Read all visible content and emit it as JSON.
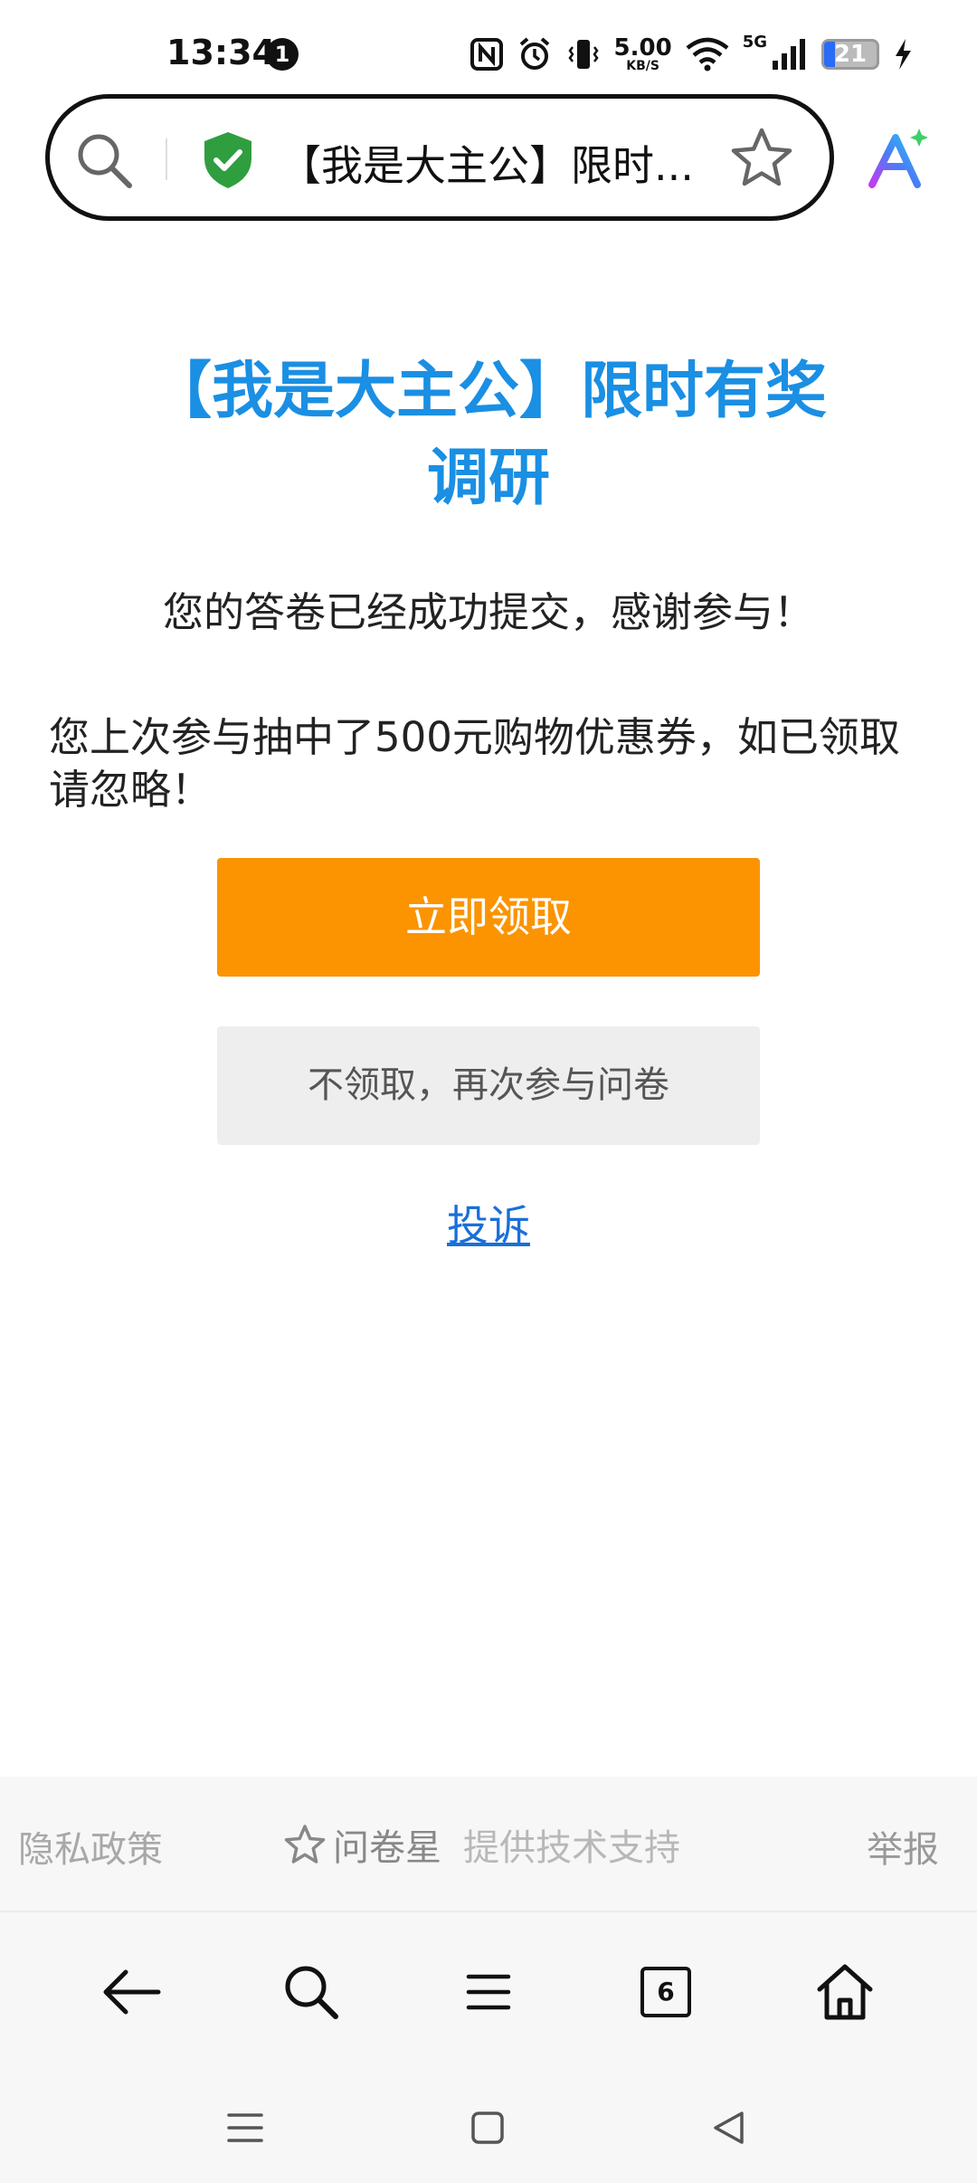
{
  "status_bar": {
    "time": "13:34",
    "notification_count": "1",
    "net_speed_value": "5.00",
    "net_speed_unit": "KB/S",
    "network_type": "5G",
    "battery_level": "21"
  },
  "address_bar": {
    "title": "【我是大主公】限时..."
  },
  "main": {
    "title": "【我是大主公】限时有奖调研",
    "success_message": "您的答卷已经成功提交，感谢参与！",
    "prize_message": "您上次参与抽中了500元购物优惠券，如已领取请忽略！",
    "claim_button_label": "立即领取",
    "skip_button_label": "不领取，再次参与问卷",
    "complaint_link_label": "投诉"
  },
  "footer": {
    "privacy_label": "隐私政策",
    "brand_name": "问卷星",
    "support_text": "提供技术支持",
    "report_label": "举报"
  },
  "toolbar": {
    "tab_count": "6"
  },
  "colors": {
    "title_blue": "#1a8fe3",
    "claim_orange": "#fb9400",
    "link_blue": "#1a6fd9",
    "shield_green": "#2e9e3f"
  },
  "icons": [
    "search-icon",
    "shield-check-icon",
    "star-icon",
    "ai-assistant-icon",
    "back-arrow-icon",
    "menu-icon",
    "home-icon"
  ]
}
